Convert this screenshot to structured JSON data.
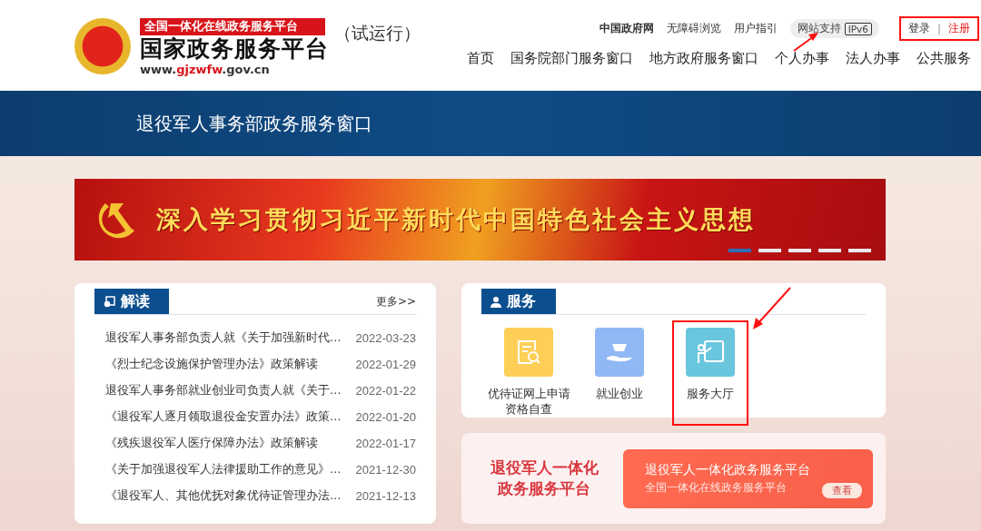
{
  "header": {
    "logo": {
      "tagline": "全国一体化在线政务服务平台",
      "name": "国家政务服务平台",
      "url": {
        "prefix": "www.",
        "highlight": "gjzwfw",
        "suffix": ".gov.cn"
      },
      "trial": "（试运行）"
    },
    "top_links": [
      {
        "label": "中国政府网",
        "kind": "strong"
      },
      {
        "label": "无障碍浏览",
        "kind": "plain"
      },
      {
        "label": "用户指引",
        "kind": "plain"
      },
      {
        "label": "网站支持",
        "badge": "IPv6",
        "kind": "pill"
      }
    ],
    "auth": {
      "annotated": true,
      "login": "登录",
      "separator": "|",
      "register": "注册"
    },
    "nav": [
      {
        "label": "首页"
      },
      {
        "label": "国务院部门服务窗口"
      },
      {
        "label": "地方政府服务窗口"
      },
      {
        "label": "个人办事"
      },
      {
        "label": "法人办事"
      },
      {
        "label": "公共服务"
      }
    ]
  },
  "page_title": "退役军人事务部政务服务窗口",
  "banner": {
    "slogan": "深入学习贯彻习近平新时代中国特色社会主义思想",
    "dots": [
      {
        "selected": true
      },
      {
        "selected": false
      },
      {
        "selected": false
      },
      {
        "selected": false
      },
      {
        "selected": false
      }
    ]
  },
  "news": {
    "title": "解读",
    "more": "更多>>",
    "items": [
      {
        "title": "退役军人事务部负责人就《关于加强新时代…",
        "date": "2022-03-23"
      },
      {
        "title": "《烈士纪念设施保护管理办法》政策解读",
        "date": "2022-01-29"
      },
      {
        "title": "退役军人事务部就业创业司负责人就《关于…",
        "date": "2022-01-22"
      },
      {
        "title": "《退役军人逐月领取退役金安置办法》政策…",
        "date": "2022-01-20"
      },
      {
        "title": "《残疾退役军人医疗保障办法》政策解读",
        "date": "2022-01-17"
      },
      {
        "title": "《关于加强退役军人法律援助工作的意见》…",
        "date": "2021-12-30"
      },
      {
        "title": "《退役军人、其他优抚对象优待证管理办法…",
        "date": "2021-12-13"
      }
    ]
  },
  "services": {
    "title": "服务",
    "items": [
      {
        "label": "优待证网上申请资格自查",
        "kind": "search-doc",
        "color": "#fdcf56",
        "annotated": false
      },
      {
        "label": "就业创业",
        "kind": "hand",
        "color": "#8fb8f5",
        "annotated": false
      },
      {
        "label": "服务大厅",
        "kind": "teacher",
        "color": "#6ac6dc",
        "annotated": true
      }
    ]
  },
  "platform": {
    "left_title": "退役军人一体化政务服务平台",
    "card_title": "退役军人一体化政务服务平台",
    "card_subtitle": "全国一体化在线政务服务平台",
    "button": "查看"
  }
}
